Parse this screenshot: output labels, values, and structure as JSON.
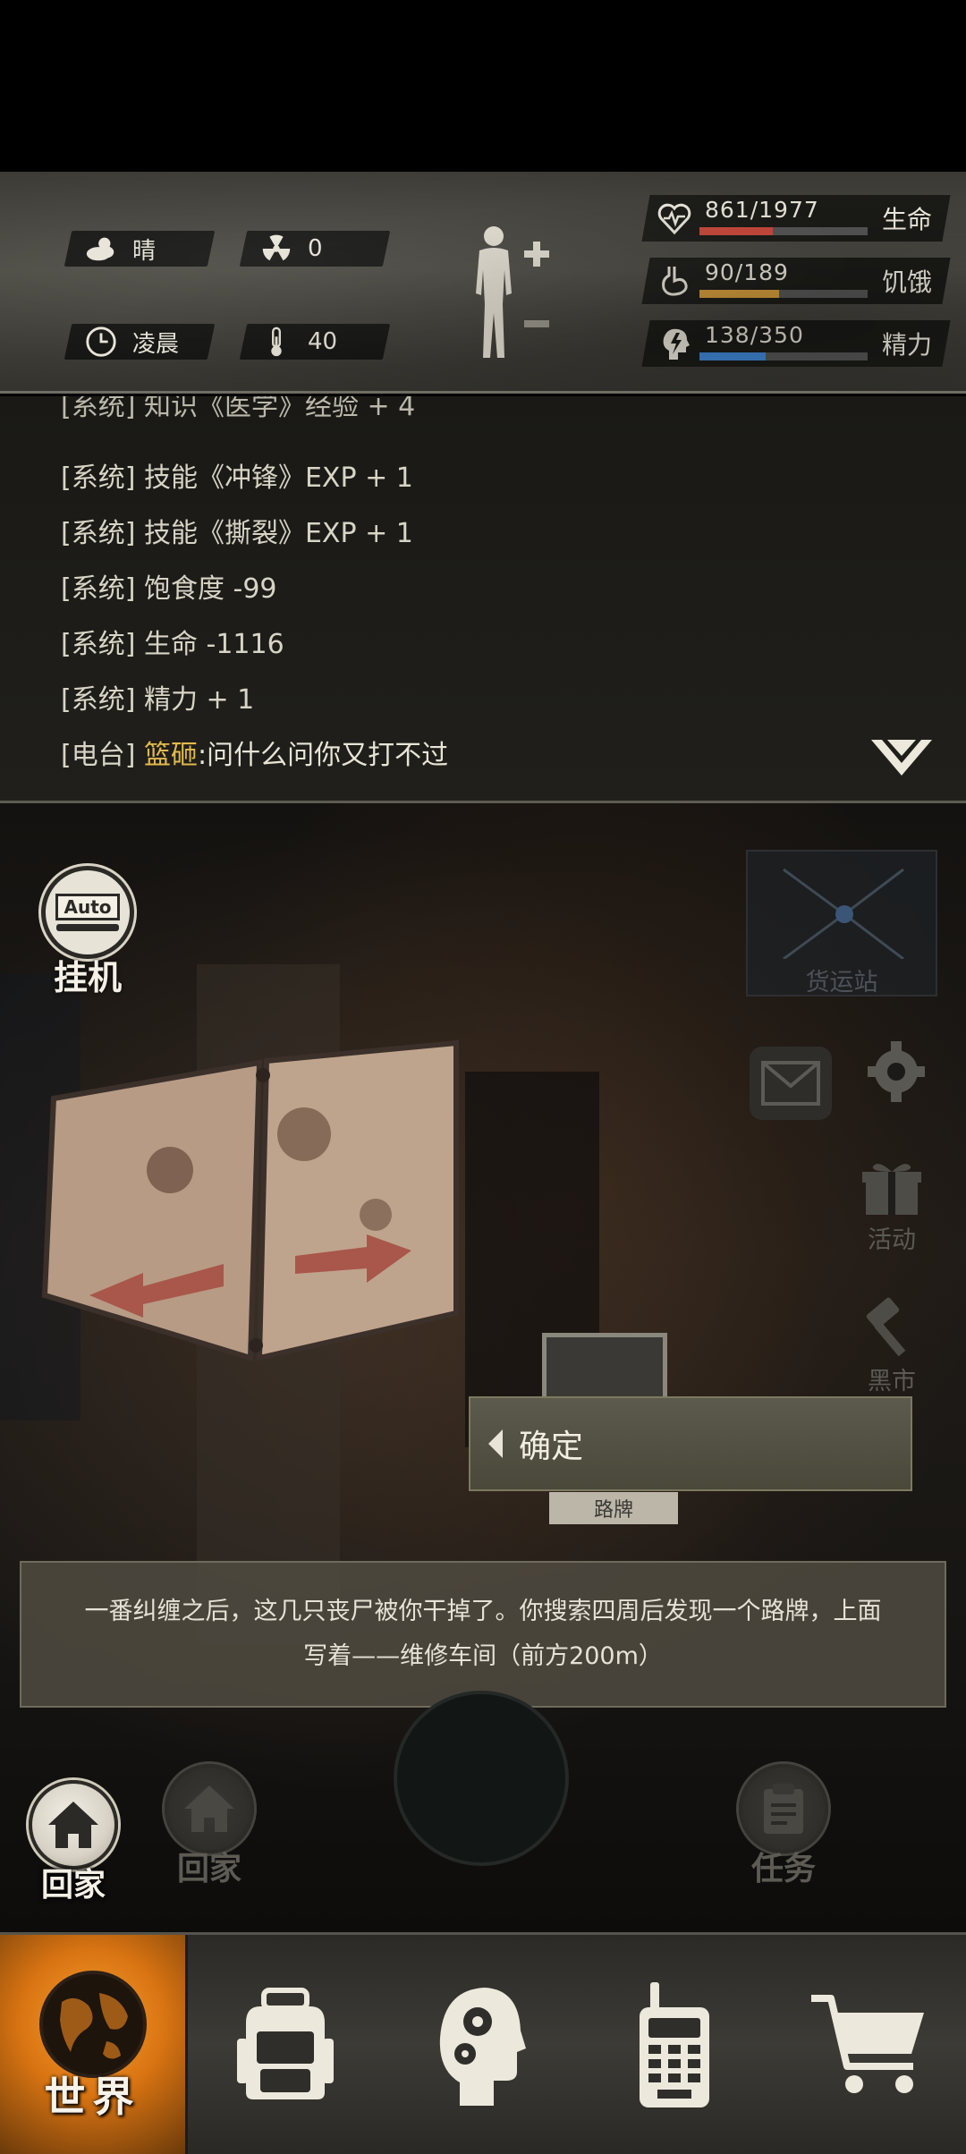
{
  "status": {
    "weather": {
      "icon": "cloud-sun-icon",
      "label": "晴"
    },
    "radiation": {
      "icon": "radiation-icon",
      "value": "0"
    },
    "time": {
      "icon": "clock-icon",
      "label": "凌晨"
    },
    "temperature": {
      "icon": "thermometer-icon",
      "value": "40"
    },
    "body_icon": "body-status-icon",
    "stats": [
      {
        "name": "health",
        "icon": "heart-pulse-icon",
        "text": "861/1977",
        "label": "生命",
        "fraction": 0.435,
        "color": "#c8483a"
      },
      {
        "name": "hunger",
        "icon": "stomach-icon",
        "text": "90/189",
        "label": "饥饿",
        "fraction": 0.476,
        "color": "#d39a3a"
      },
      {
        "name": "energy",
        "icon": "head-bolt-icon",
        "text": "138/350",
        "label": "精力",
        "fraction": 0.394,
        "color": "#3f86d2"
      }
    ]
  },
  "log": {
    "lines": [
      {
        "tag": "[系统]",
        "text": "知识《医学》经验 + 4"
      },
      {
        "tag": "[系统]",
        "text": "技能《冲锋》EXP + 1"
      },
      {
        "tag": "[系统]",
        "text": "技能《撕裂》EXP + 1"
      },
      {
        "tag": "[系统]",
        "text": "饱食度 -99"
      },
      {
        "tag": "[系统]",
        "text": "生命 -1116"
      },
      {
        "tag": "[系统]",
        "text": "精力 + 1"
      }
    ],
    "radio": {
      "tag": "[电台]",
      "speaker": "篮砸",
      "message": ":问什么问你又打不过"
    },
    "expand_icon": "double-chevron-down-icon"
  },
  "scene": {
    "auto": {
      "badge": "Auto",
      "label": "挂机"
    },
    "freight": {
      "label": "货运站"
    },
    "mail_icon": "mail-icon",
    "settings_icon": "gear-icon",
    "events": {
      "label": "活动"
    },
    "black_market": {
      "label": "黑市"
    },
    "sign_text": "路牌",
    "confirm": {
      "label": "确定"
    },
    "narration": {
      "line1": "一番纠缠之后，这几只丧尸被你干掉了。你搜索四周后发现一个路牌，上面",
      "line2": "写着——维修车间（前方200m）"
    },
    "home_active": {
      "label": "回家"
    },
    "home_dim": {
      "label": "回家"
    },
    "tasks": {
      "label": "任务"
    }
  },
  "nav": {
    "items": [
      {
        "name": "world",
        "icon": "globe-icon",
        "label": "世界",
        "active": true
      },
      {
        "name": "backpack",
        "icon": "backpack-icon",
        "label": ""
      },
      {
        "name": "skills",
        "icon": "head-gears-icon",
        "label": ""
      },
      {
        "name": "radio",
        "icon": "walkie-talkie-icon",
        "label": ""
      },
      {
        "name": "shop",
        "icon": "cart-icon",
        "label": ""
      }
    ]
  }
}
